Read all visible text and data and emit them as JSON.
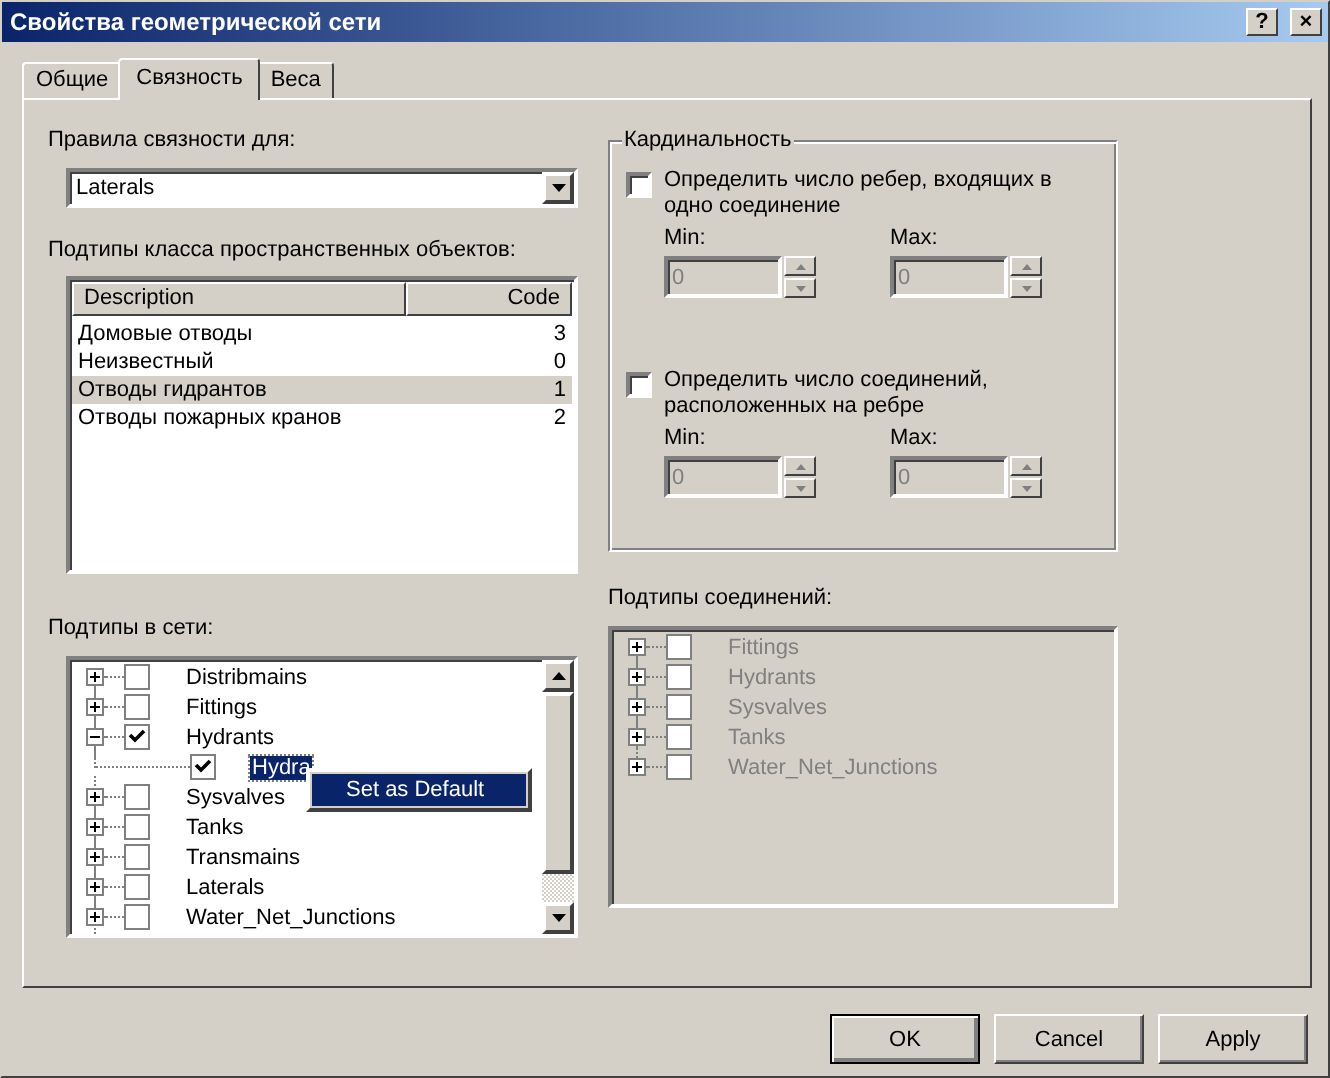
{
  "window": {
    "title": "Свойства геометрической сети",
    "controls": [
      {
        "kind": "help",
        "label": "?"
      },
      {
        "kind": "close",
        "label": "×"
      }
    ]
  },
  "tabs": [
    {
      "label": "Общие",
      "selected": false
    },
    {
      "label": "Связность",
      "selected": true
    },
    {
      "label": "Веса",
      "selected": false
    }
  ],
  "rules": {
    "label": "Правила связности для:",
    "dropdown": {
      "value": "Laterals"
    }
  },
  "feature_subtypes": {
    "label": "Подтипы класса пространственных объектов:",
    "columns": [
      "Description",
      "Code"
    ],
    "rows": [
      {
        "description": "Домовые отводы",
        "code": "3",
        "selected": false
      },
      {
        "description": "Неизвестный",
        "code": "0",
        "selected": false
      },
      {
        "description": "Отводы гидрантов",
        "code": "1",
        "selected": true
      },
      {
        "description": "Отводы пожарных кранов",
        "code": "2",
        "selected": false
      }
    ]
  },
  "cardinality": {
    "title": "Кардинальность",
    "groups": [
      {
        "label": "Определить число ребер, входящих в одно соединение",
        "checked": false,
        "disabled": true,
        "min_label": "Min:",
        "min_value": "0",
        "max_label": "Max:",
        "max_value": "0"
      },
      {
        "label": "Определить число соединений, расположенных на ребре",
        "checked": false,
        "disabled": true,
        "min_label": "Min:",
        "min_value": "0",
        "max_label": "Max:",
        "max_value": "0"
      }
    ]
  },
  "network_subtypes": {
    "label": "Подтипы в сети:",
    "disabled": false,
    "items": [
      {
        "label": "Distribmains",
        "checked": false,
        "expanded": false,
        "selected": false
      },
      {
        "label": "Fittings",
        "checked": false,
        "expanded": false,
        "selected": false
      },
      {
        "label": "Hydrants",
        "checked": true,
        "expanded": true,
        "selected": false,
        "children": [
          {
            "label": "Hydra",
            "checked": true,
            "selected": true
          }
        ]
      },
      {
        "label": "Sysvalves",
        "checked": false,
        "expanded": false,
        "selected": false
      },
      {
        "label": "Tanks",
        "checked": false,
        "expanded": false,
        "selected": false
      },
      {
        "label": "Transmains",
        "checked": false,
        "expanded": false,
        "selected": false
      },
      {
        "label": "Laterals",
        "checked": false,
        "expanded": false,
        "selected": false
      },
      {
        "label": "Water_Net_Junctions",
        "checked": false,
        "expanded": false,
        "selected": false
      }
    ]
  },
  "context_menu": {
    "items": [
      {
        "label": "Set as Default",
        "selected": true
      }
    ]
  },
  "junction_subtypes": {
    "label": "Подтипы соединений:",
    "disabled": true,
    "items": [
      {
        "label": "Fittings",
        "checked": false,
        "expanded": false,
        "selected": false
      },
      {
        "label": "Hydrants",
        "checked": false,
        "expanded": false,
        "selected": false
      },
      {
        "label": "Sysvalves",
        "checked": false,
        "expanded": false,
        "selected": false
      },
      {
        "label": "Tanks",
        "checked": false,
        "expanded": false,
        "selected": false
      },
      {
        "label": "Water_Net_Junctions",
        "checked": false,
        "expanded": false,
        "selected": false
      }
    ]
  },
  "buttons": [
    {
      "label": "OK",
      "default": true
    },
    {
      "label": "Cancel",
      "default": false
    },
    {
      "label": "Apply",
      "default": false
    }
  ]
}
